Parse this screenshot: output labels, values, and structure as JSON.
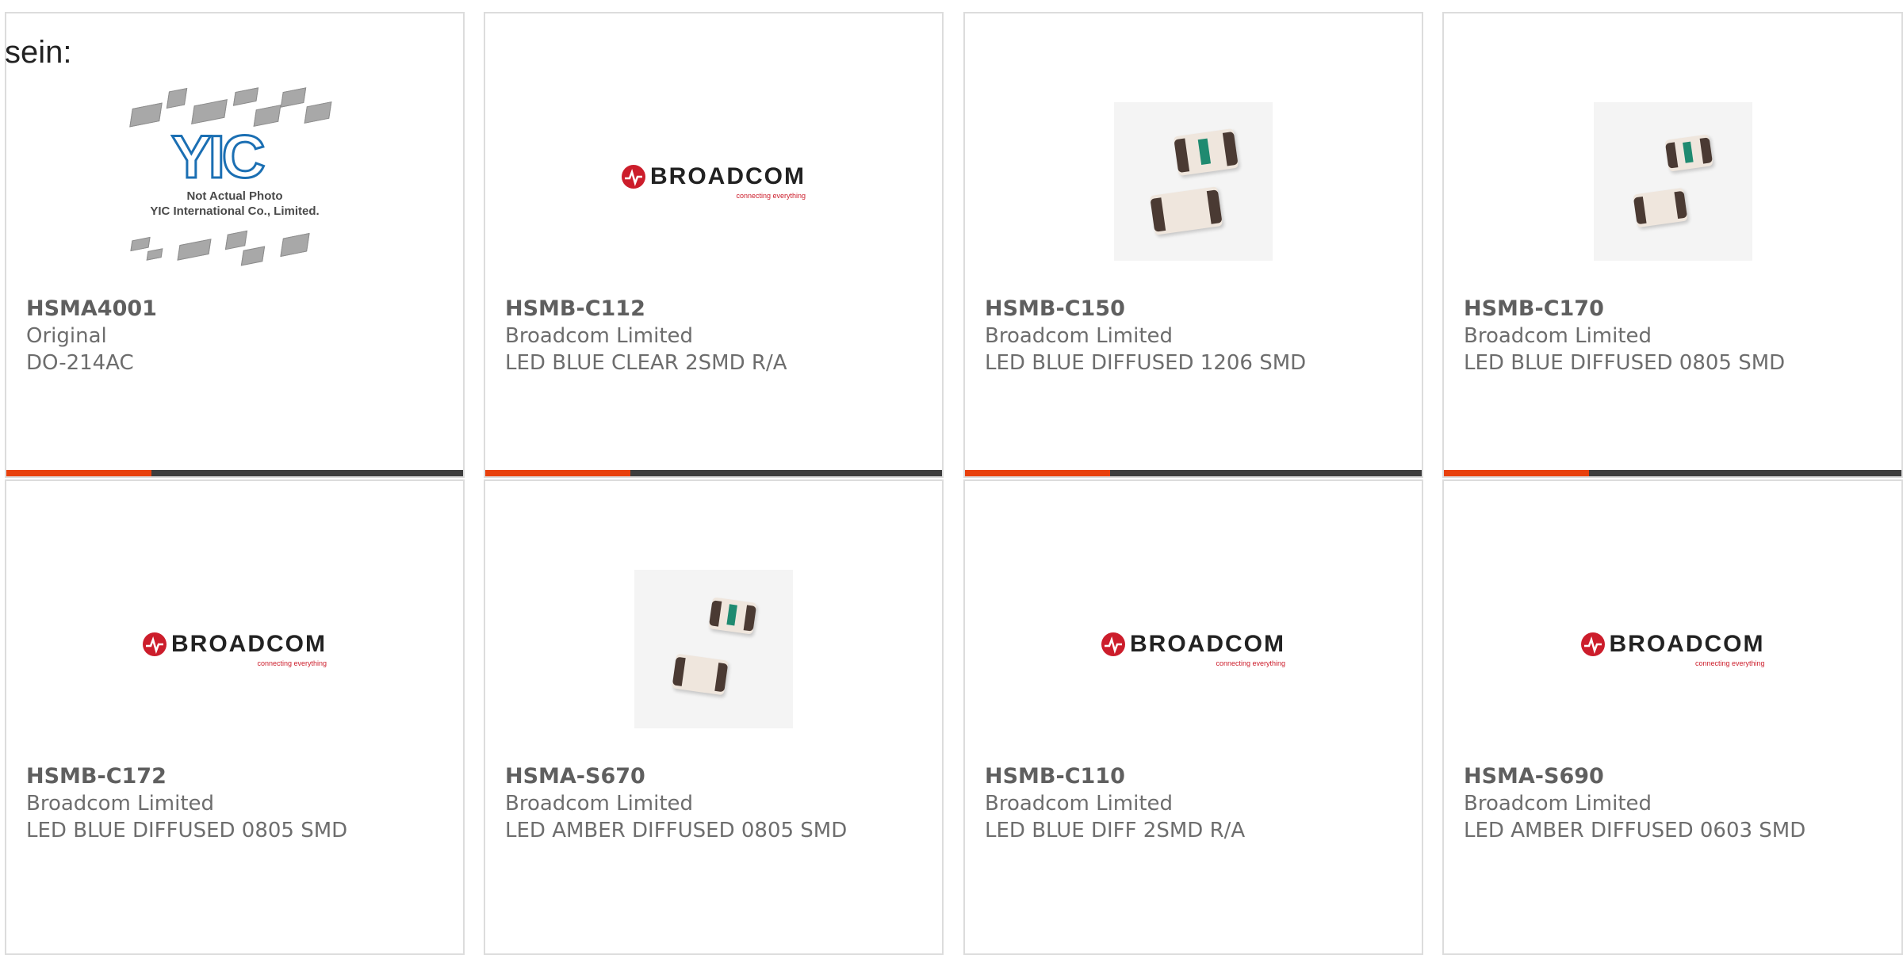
{
  "lead_text": "sein:",
  "products": [
    {
      "part": "HSMA4001",
      "maker": "Original",
      "description": "DO-214AC",
      "image": "yic-not-actual-photo"
    },
    {
      "part": "HSMB-C112",
      "maker": "Broadcom Limited",
      "description": "LED BLUE CLEAR 2SMD R/A",
      "image": "broadcom-logo"
    },
    {
      "part": "HSMB-C150",
      "maker": "Broadcom Limited",
      "description": "LED BLUE DIFFUSED 1206 SMD",
      "image": "smd-led-photo"
    },
    {
      "part": "HSMB-C170",
      "maker": "Broadcom Limited",
      "description": "LED BLUE DIFFUSED 0805 SMD",
      "image": "smd-led-photo"
    },
    {
      "part": "HSMB-C172",
      "maker": "Broadcom Limited",
      "description": "LED BLUE DIFFUSED 0805 SMD",
      "image": "broadcom-logo"
    },
    {
      "part": "HSMA-S670",
      "maker": "Broadcom Limited",
      "description": "LED AMBER DIFFUSED 0805 SMD",
      "image": "smd-led-photo"
    },
    {
      "part": "HSMB-C110",
      "maker": "Broadcom Limited",
      "description": "LED BLUE DIFF 2SMD R/A",
      "image": "broadcom-logo"
    },
    {
      "part": "HSMA-S690",
      "maker": "Broadcom Limited",
      "description": "LED AMBER DIFFUSED 0603 SMD",
      "image": "broadcom-logo"
    }
  ],
  "broadcom": {
    "word": "BROADCOM",
    "tagline": "connecting everything"
  },
  "yic": {
    "word": "YIC",
    "caption1": "Not Actual Photo",
    "caption2": "YIC International Co., Limited."
  },
  "colors": {
    "accent": "#e8400c",
    "bar": "#3d3d3d",
    "brand_red": "#cc1d2b"
  }
}
